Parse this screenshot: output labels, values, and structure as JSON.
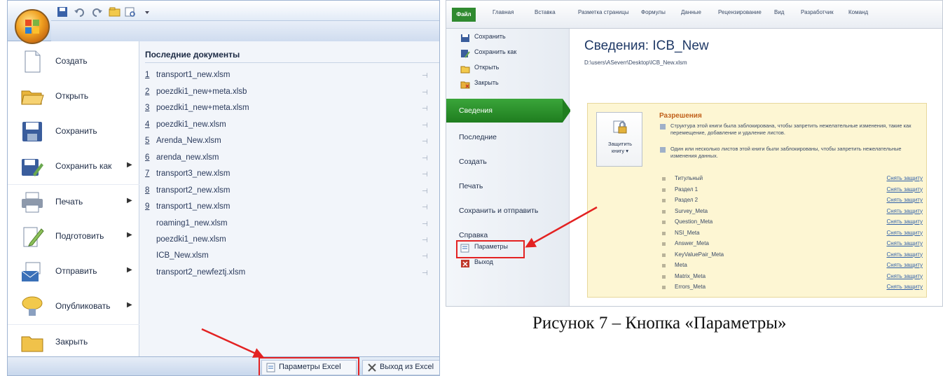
{
  "left_menu": {
    "items": [
      {
        "label": "Создать",
        "icon": "new-document-icon",
        "arrow": false
      },
      {
        "label": "Открыть",
        "icon": "open-folder-icon",
        "arrow": false
      },
      {
        "label": "Сохранить",
        "icon": "save-disk-icon",
        "arrow": false
      },
      {
        "label": "Сохранить как",
        "icon": "save-as-icon",
        "arrow": true
      },
      {
        "label": "Печать",
        "icon": "printer-icon",
        "arrow": true
      },
      {
        "label": "Подготовить",
        "icon": "prepare-icon",
        "arrow": true
      },
      {
        "label": "Отправить",
        "icon": "send-icon",
        "arrow": true
      },
      {
        "label": "Опубликовать",
        "icon": "publish-icon",
        "arrow": true
      },
      {
        "label": "Закрыть",
        "icon": "close-folder-icon",
        "arrow": false
      }
    ]
  },
  "recent": {
    "title": "Последние документы",
    "items": [
      {
        "num": "1",
        "name": "transport1_new.xlsm"
      },
      {
        "num": "2",
        "name": "poezdki1_new+meta.xlsb"
      },
      {
        "num": "3",
        "name": "poezdki1_new+meta.xlsm"
      },
      {
        "num": "4",
        "name": "poezdki1_new.xlsm"
      },
      {
        "num": "5",
        "name": "Arenda_New.xlsm"
      },
      {
        "num": "6",
        "name": "arenda_new.xlsm"
      },
      {
        "num": "7",
        "name": "transport3_new.xlsm"
      },
      {
        "num": "8",
        "name": "transport2_new.xlsm"
      },
      {
        "num": "9",
        "name": "transport1_new.xlsm"
      },
      {
        "num": "",
        "name": "roaming1_new.xlsm"
      },
      {
        "num": "",
        "name": "poezdki1_new.xlsm"
      },
      {
        "num": "",
        "name": "ICB_New.xlsm"
      },
      {
        "num": "",
        "name": "transport2_newfeztj.xlsm"
      }
    ]
  },
  "bottom": {
    "options_label": "Параметры Excel",
    "exit_label": "Выход из Excel"
  },
  "ribbon": {
    "file_tab": "Файл",
    "tabs": [
      "Главная",
      "Вставка",
      "Разметка страницы",
      "Формулы",
      "Данные",
      "Рецензирование",
      "Вид",
      "Разработчик",
      "Команд"
    ]
  },
  "backstage": {
    "small_items": [
      {
        "label": "Сохранить",
        "icon": "save-icon"
      },
      {
        "label": "Сохранить как",
        "icon": "save-as-icon"
      },
      {
        "label": "Открыть",
        "icon": "open-icon"
      },
      {
        "label": "Закрыть",
        "icon": "close-icon"
      }
    ],
    "big_items": [
      {
        "label": "Сведения",
        "active": true
      },
      {
        "label": "Последние",
        "active": false
      },
      {
        "label": "Создать",
        "active": false
      },
      {
        "label": "Печать",
        "active": false
      },
      {
        "label": "Сохранить и отправить",
        "active": false
      },
      {
        "label": "Справка",
        "active": false
      }
    ],
    "options_label": "Параметры",
    "exit_label": "Выход"
  },
  "info": {
    "title": "Сведения: ICB_New",
    "path": "D:\\users\\ASeverr\\Desktop\\ICB_New.xlsm",
    "protect_button": "Защитить\nкнигу ▾",
    "permissions_title": "Разрешения",
    "text1": "Структура этой книги была заблокирована, чтобы запретить нежелательные изменения, такие как перемещение, добавление и удаление листов.",
    "text2": "Один или несколько листов этой книги были заблокированы, чтобы запретить нежелательные изменения данных.",
    "unprotect_label": "Снять защиту",
    "sheets": [
      "Титульный",
      "Раздел 1",
      "Раздел 2",
      "Survey_Meta",
      "Question_Meta",
      "NSI_Meta",
      "Answer_Meta",
      "KeyValuePair_Meta",
      "Meta",
      "Matrix_Meta",
      "Errors_Meta"
    ]
  },
  "caption": "Рисунок 7 – Кнопка «Параметры»",
  "colors": {
    "highlight": "#e32222",
    "file_tab": "#2f8a2f",
    "permissions_bg": "#fdf6d3"
  }
}
